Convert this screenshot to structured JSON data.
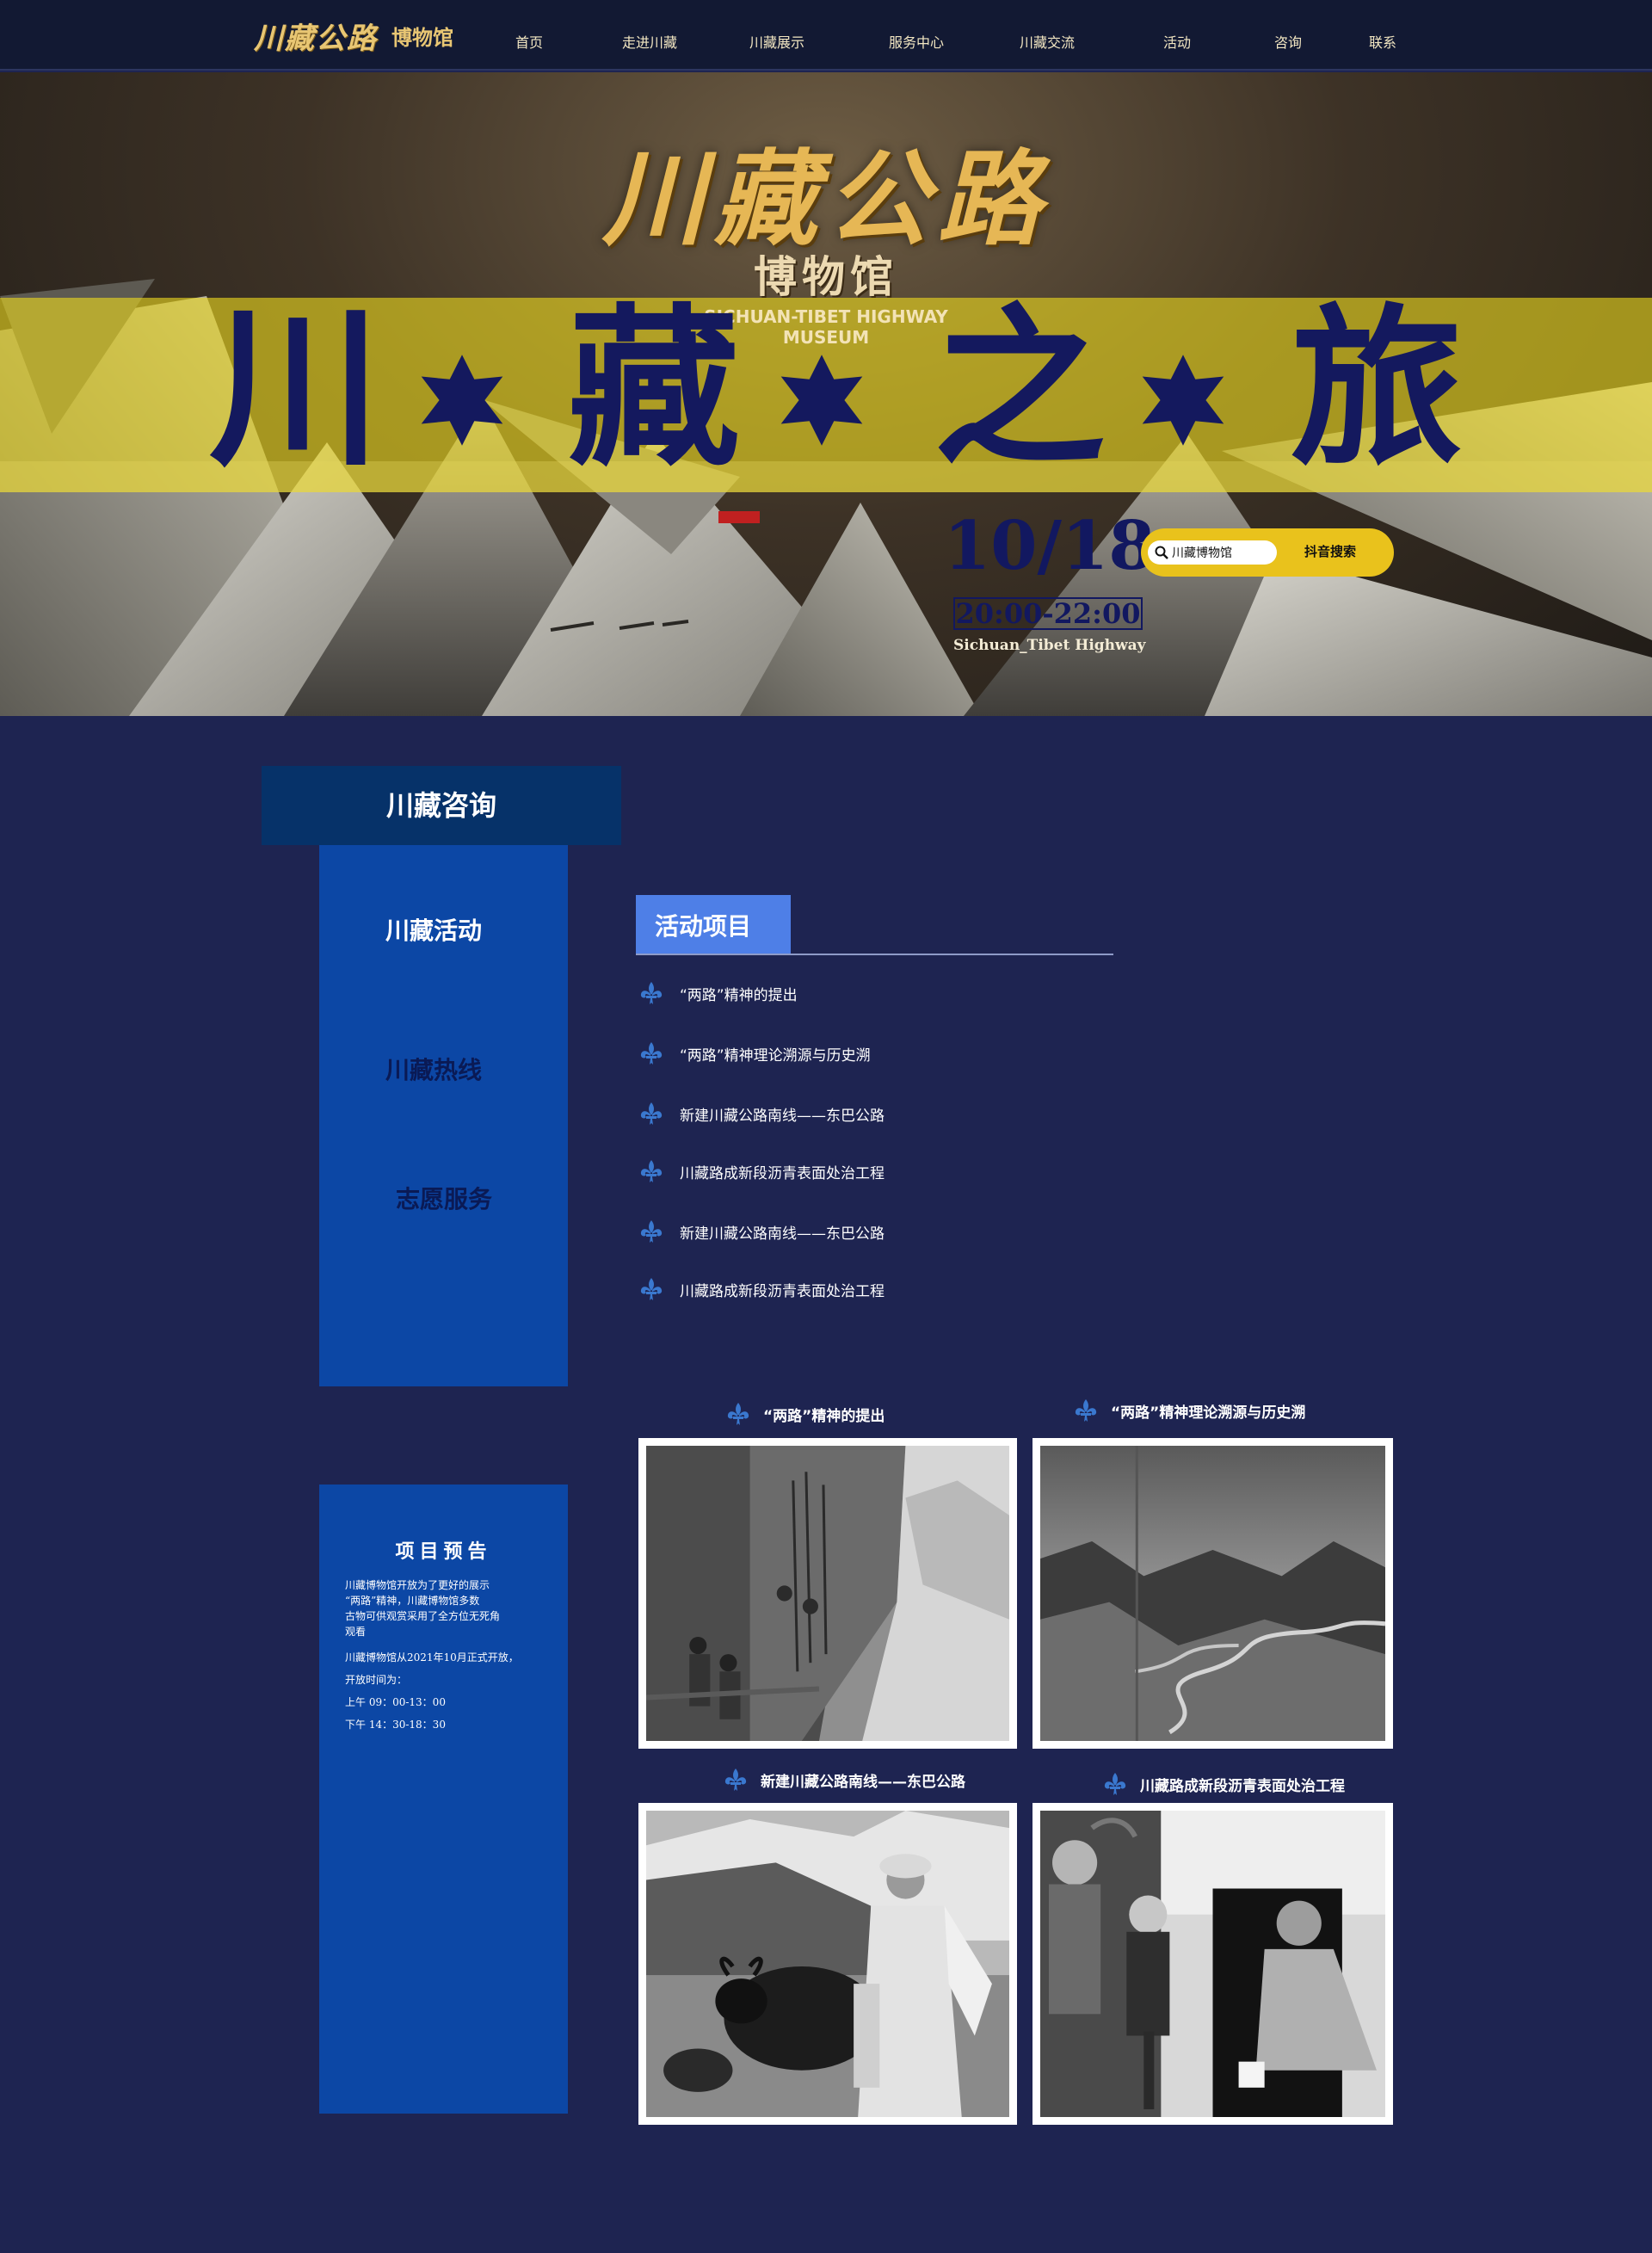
{
  "header": {
    "logo_script": "川藏公路",
    "logo_sub": "博物馆",
    "nav": [
      {
        "label": "首页"
      },
      {
        "label": "走进川藏"
      },
      {
        "label": "川藏展示"
      },
      {
        "label": "服务中心"
      },
      {
        "label": "川藏交流"
      },
      {
        "label": "活动"
      },
      {
        "label": "咨询"
      },
      {
        "label": "联系"
      }
    ]
  },
  "hero": {
    "title": "川藏公路",
    "museum": "博物馆",
    "museum_en_1": "SICHUAN-TIBET HIGHWAY",
    "museum_en_2": "MUSEUM",
    "band_chars": [
      "川",
      "藏",
      "之",
      "旅"
    ],
    "date": "10/18",
    "time": "20:00-22:00",
    "subtitle": "Sichuan_Tibet Highway",
    "search_value": "川藏博物馆",
    "search_button": "抖音搜索",
    "colors": {
      "band": "#ecd81e",
      "text": "#14195e",
      "pill": "#e9c21c"
    }
  },
  "sidebar": {
    "heading": "川藏咨询",
    "items": [
      {
        "label": "川藏活动",
        "color": "#ffffff"
      },
      {
        "label": "川藏热线",
        "color": "#0a1a55"
      },
      {
        "label": "志愿服务",
        "color": "#0a1a55"
      }
    ]
  },
  "notice": {
    "title": "项目预告",
    "lines": [
      "川藏博物馆开放为了更好的展示",
      "“两路”精神，川藏博物馆多数",
      "古物可供观赏采用了全方位无死角",
      "观看",
      "川藏博物馆从2021年10月正式开放，",
      "开放时间为：",
      "上午 09：00-13：00",
      "下午 14：30-18：30"
    ]
  },
  "activities": {
    "tab": "活动项目",
    "items": [
      {
        "label": "“两路”精神的提出"
      },
      {
        "label": "“两路”精神理论溯源与历史溯"
      },
      {
        "label": "新建川藏公路南线——东巴公路"
      },
      {
        "label": "川藏路成新段沥青表面处治工程"
      },
      {
        "label": "新建川藏公路南线——东巴公路"
      },
      {
        "label": "川藏路成新段沥青表面处治工程"
      }
    ]
  },
  "gallery": [
    {
      "caption": "“两路”精神的提出",
      "subject": "workers-on-cliff-photo"
    },
    {
      "caption": "“两路”精神理论溯源与历史溯",
      "subject": "mountain-road-photo"
    },
    {
      "caption": "新建川藏公路南线——东巴公路",
      "subject": "woman-with-yak-photo"
    },
    {
      "caption": "川藏路成新段沥青表面处治工程",
      "subject": "people-portrait-photo"
    }
  ],
  "icons": {
    "list_bullet": "fleur-de-lis-icon",
    "search": "search-icon",
    "band_star": "star-icon"
  },
  "theme": {
    "page_bg": "#1e2451",
    "panel": "#0c47a5",
    "panel_head": "#063269",
    "tab": "#4e7fe7",
    "fleur": "#3a78cf"
  }
}
